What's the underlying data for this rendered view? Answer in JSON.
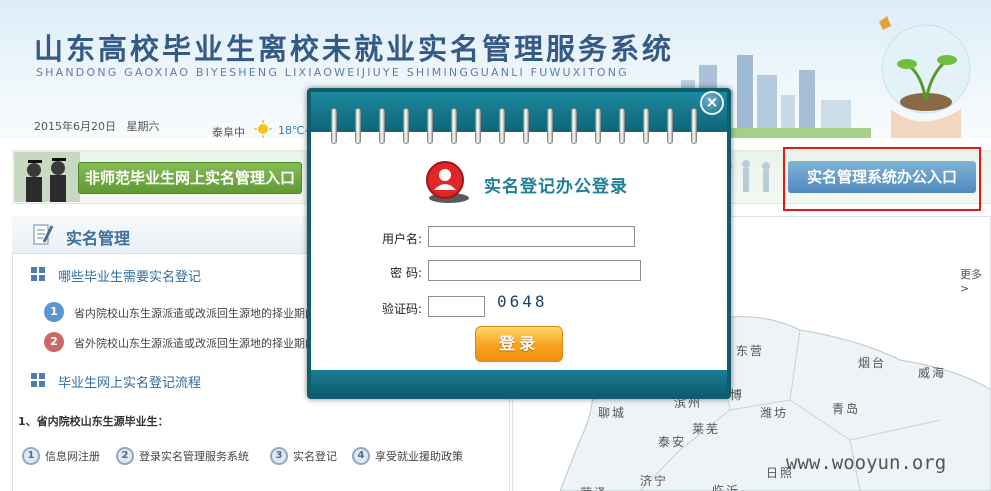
{
  "header": {
    "title": "山东高校毕业生离校未就业实名管理服务系统",
    "subtitle": "SHANDONG GAOXIAO BIYESHENG LIXIAOWEIJIUYE SHIMINGGUANLI FUWUXITONG",
    "date": "2015年6月20日",
    "weekday": "星期六",
    "weather_city": "泰阜中",
    "weather_temp": "18℃~"
  },
  "entry": {
    "left_label": "非师范毕业生网上实名管理入口",
    "right_label": "实名管理系统办公入口"
  },
  "left_panel": {
    "title": "实名管理",
    "section1_title": "哪些毕业生需要实名登记",
    "items": [
      {
        "num": "1",
        "text": "省内院校山东生源派遣或改派回生源地的择业期内毕业生"
      },
      {
        "num": "2",
        "text": "省外院校山东生源派遣或改派回生源地的择业期内毕业生"
      }
    ],
    "section2_title": "毕业生网上实名登记流程",
    "province_label": "1、省内院校山东生源毕业生：",
    "steps": [
      {
        "num": "1",
        "label": "信息网注册"
      },
      {
        "num": "2",
        "label": "登录实名管理服务系统"
      },
      {
        "num": "3",
        "label": "实名登记"
      },
      {
        "num": "4",
        "label": "享受就业援助政策"
      }
    ]
  },
  "map_panel": {
    "more_label": "更多>",
    "cities": [
      "东营",
      "烟台",
      "威海",
      "滨州",
      "博",
      "潍坊",
      "青岛",
      "聊城",
      "莱芜",
      "泰安",
      "日照",
      "济宁",
      "临沂",
      "菏泽"
    ]
  },
  "login": {
    "heading": "实名登记办公登录",
    "username_label": "用户名:",
    "password_label": "密 码:",
    "captcha_label": "验证码:",
    "captcha_code": "0648",
    "username_value": "",
    "password_value": "",
    "captcha_value": "",
    "login_label": "登录",
    "close_label": "×"
  },
  "watermark": "www.wooyun.org",
  "colors": {
    "modal_teal": "#0f5e6e",
    "login_orange": "#f7a11c",
    "highlight_red": "#e21818",
    "entry_green": "#5f9a34",
    "entry_blue": "#4f8abd"
  }
}
